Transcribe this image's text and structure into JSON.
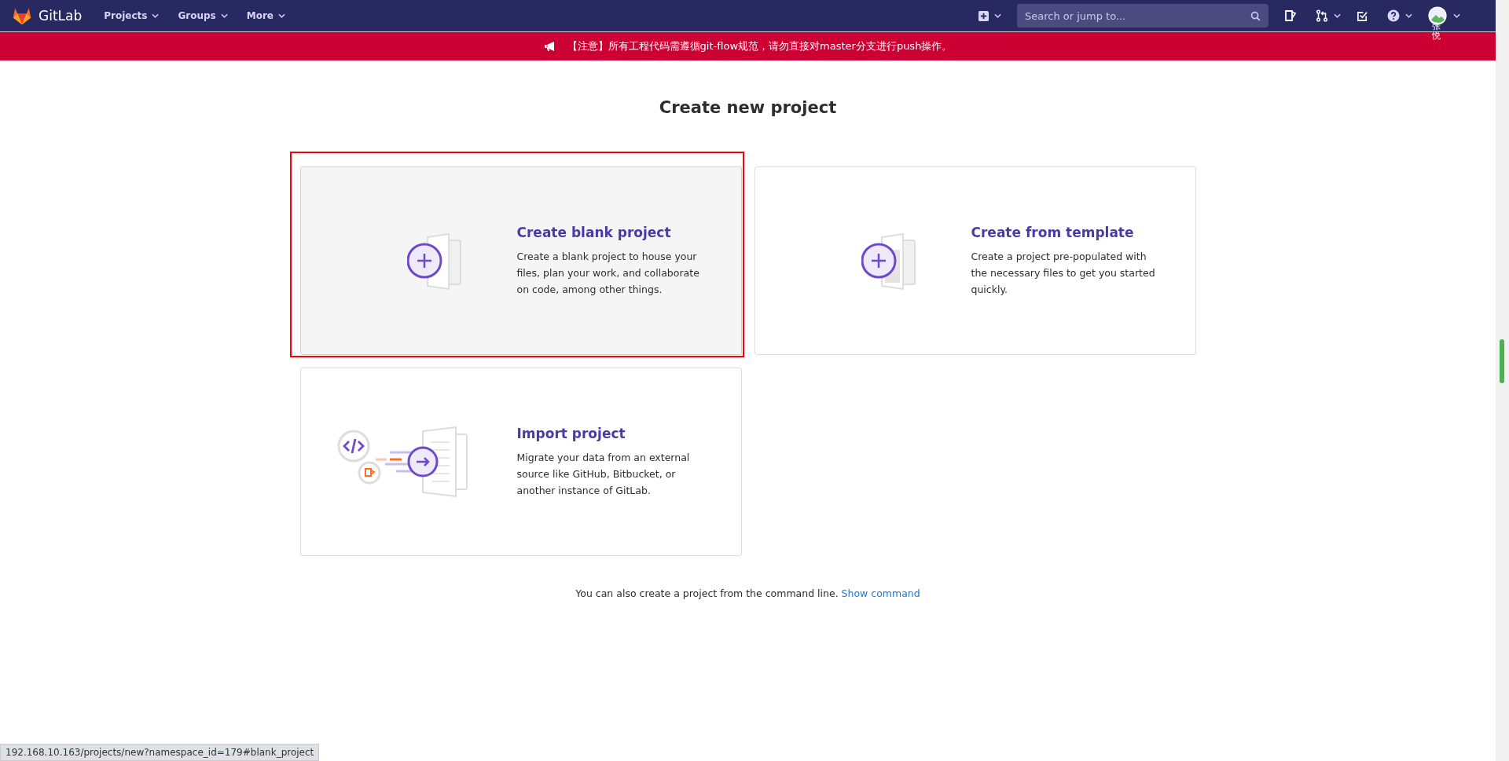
{
  "navbar": {
    "brand": "GitLab",
    "menus": [
      {
        "label": "Projects"
      },
      {
        "label": "Groups"
      },
      {
        "label": "More"
      }
    ],
    "search": {
      "placeholder": "Search or jump to..."
    },
    "avatar_alt": "张悦"
  },
  "banner": {
    "text": "【注意】所有工程代码需遵循git-flow规范，请勿直接对master分支进行push操作。"
  },
  "page": {
    "title": "Create new project",
    "options": [
      {
        "kind": "blank",
        "title": "Create blank project",
        "description": "Create a blank project to house your files, plan your work, and collaborate on code, among other things.",
        "hovered": true,
        "outlined": true
      },
      {
        "kind": "template",
        "title": "Create from template",
        "description": "Create a project pre-populated with the necessary files to get you started quickly.",
        "hovered": false,
        "outlined": false
      },
      {
        "kind": "import",
        "title": "Import project",
        "description": "Migrate your data from an external source like GitHub, Bitbucket, or another instance of GitLab.",
        "hovered": false,
        "outlined": false
      }
    ],
    "footer": {
      "text": "You can also create a project from the command line.",
      "link": "Show command"
    }
  },
  "status_url": "192.168.10.163/projects/new?namespace_id=179#blank_project"
}
